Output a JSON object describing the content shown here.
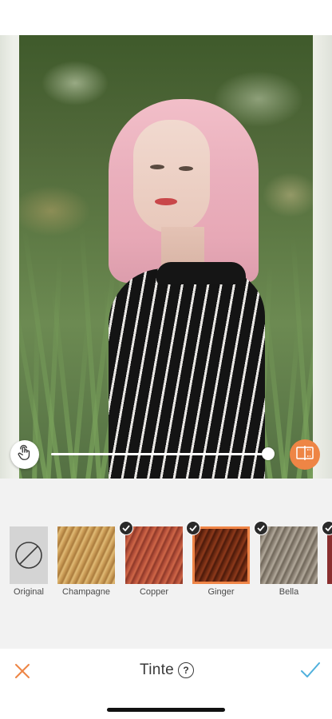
{
  "slider": {
    "value": 1.0
  },
  "swatches": [
    {
      "label": "Original",
      "name": "original",
      "checked": false,
      "selected": false,
      "icon": "no-color-icon"
    },
    {
      "label": "Champagne",
      "name": "champagne",
      "checked": false,
      "selected": false,
      "colors": [
        "#c99a55",
        "#a97a3c",
        "#e0bb76"
      ]
    },
    {
      "label": "Copper",
      "name": "copper",
      "checked": true,
      "selected": false,
      "colors": [
        "#b5503a",
        "#d06848",
        "#8d3828"
      ]
    },
    {
      "label": "Ginger",
      "name": "ginger",
      "checked": true,
      "selected": true,
      "colors": [
        "#6e2a12",
        "#8f3a1b",
        "#4a190a"
      ]
    },
    {
      "label": "Bella",
      "name": "bella",
      "checked": true,
      "selected": false,
      "colors": [
        "#8f8578",
        "#b3aa9c",
        "#6f6659"
      ]
    }
  ],
  "bottom_bar": {
    "title": "Tinte",
    "cancel_icon": "close-icon",
    "confirm_icon": "checkmark-icon",
    "help_icon": "help-icon",
    "help_glyph": "?"
  },
  "colors": {
    "accent": "#ee8545",
    "confirm": "#4fb0dc",
    "cancel": "#ee8545"
  }
}
